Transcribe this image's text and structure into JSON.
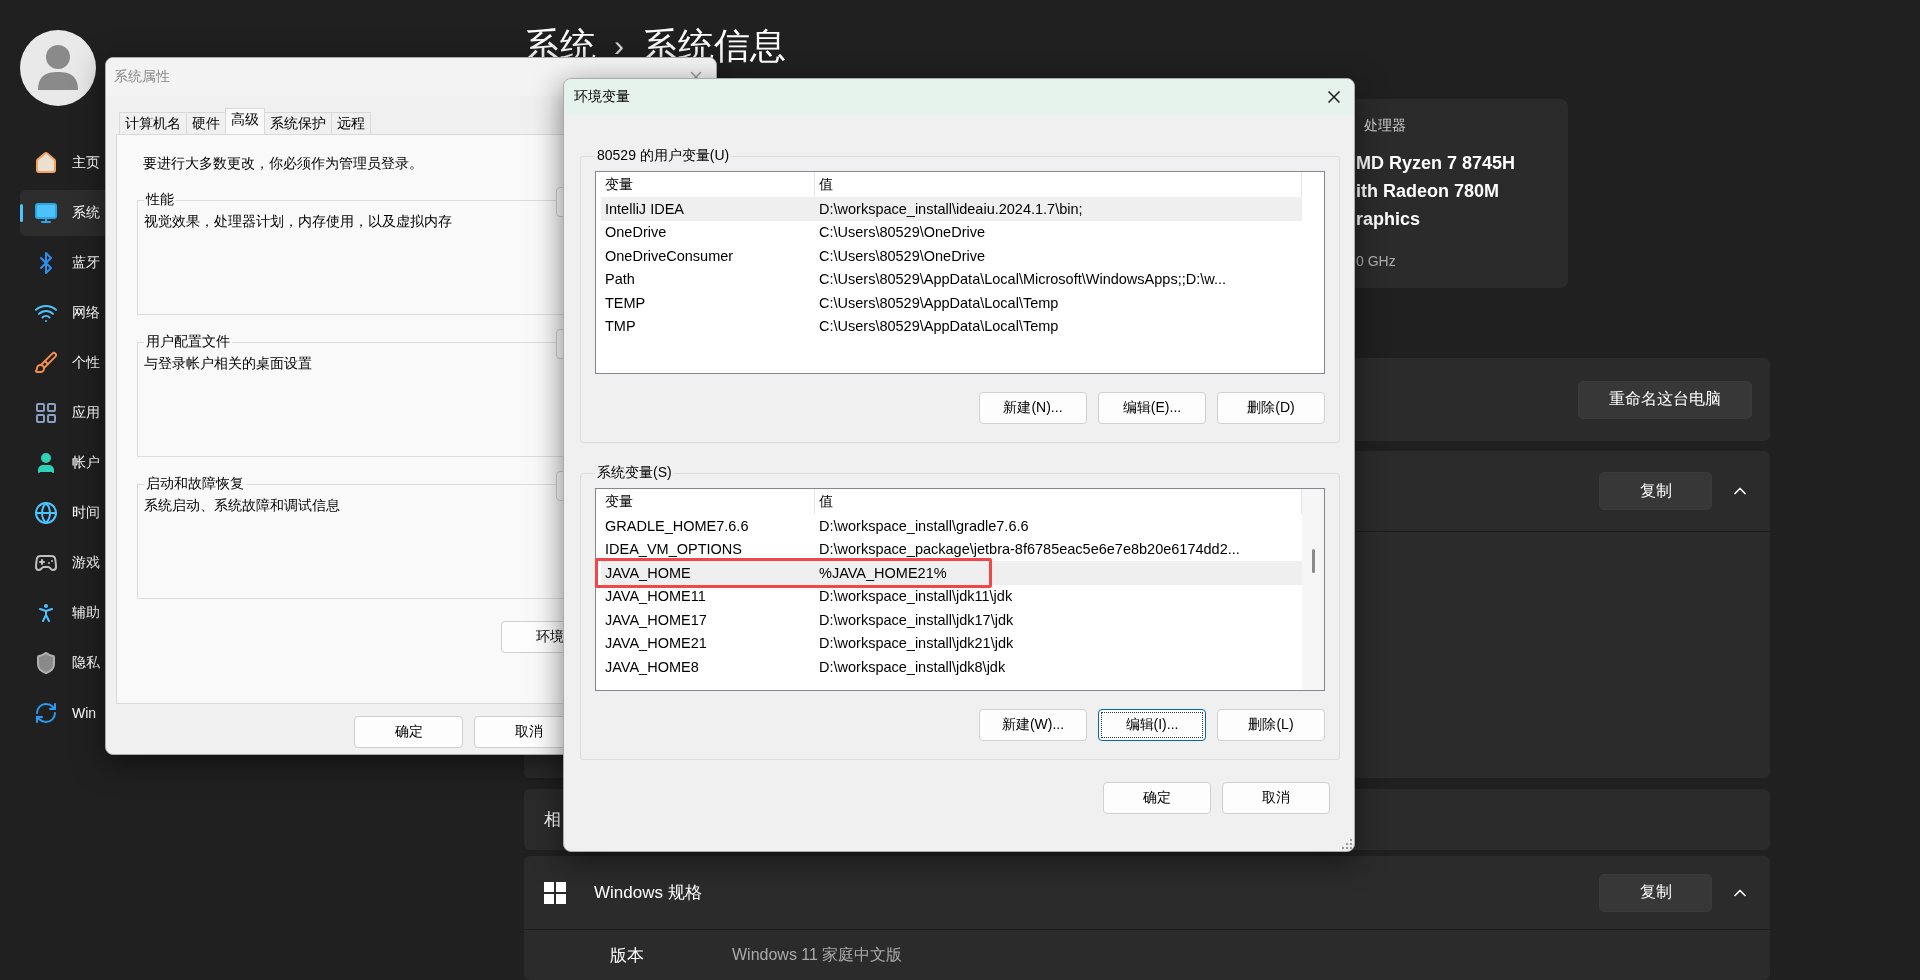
{
  "settings": {
    "breadcrumb": [
      "系统",
      "系统信息"
    ],
    "separator": "›",
    "nav": [
      {
        "label": "主页",
        "selected": false
      },
      {
        "label": "系统",
        "selected": true
      },
      {
        "label": "蓝牙",
        "selected": false
      },
      {
        "label": "网络",
        "selected": false
      },
      {
        "label": "个性",
        "selected": false
      },
      {
        "label": "应用",
        "selected": false
      },
      {
        "label": "帐户",
        "selected": false
      },
      {
        "label": "时间",
        "selected": false
      },
      {
        "label": "游戏",
        "selected": false
      },
      {
        "label": "辅助",
        "selected": false
      },
      {
        "label": "隐私",
        "selected": false
      },
      {
        "label": "Win",
        "selected": false
      }
    ],
    "processor": {
      "label": "处理器",
      "name_lines": [
        "MD Ryzen 7 8745H",
        "ith Radeon 780M",
        "raphics"
      ],
      "speed": "0 GHz"
    },
    "rename_button": "重命名这台电脑",
    "device_spec": {
      "copy_button": "复制",
      "expanded": true
    },
    "related": {
      "title": "相"
    },
    "windows_spec": {
      "title": "Windows 规格",
      "copy_button": "复制",
      "expanded": true,
      "rows": [
        {
          "label": "版本",
          "value": "Windows 11 家庭中文版"
        }
      ]
    }
  },
  "system_properties": {
    "title": "系统属性",
    "active": false,
    "tabs": [
      {
        "label": "计算机名",
        "selected": false
      },
      {
        "label": "硬件",
        "selected": false
      },
      {
        "label": "高级",
        "selected": true
      },
      {
        "label": "系统保护",
        "selected": false
      },
      {
        "label": "远程",
        "selected": false
      }
    ],
    "notice": "要进行大多数更改，你必须作为管理员登录。",
    "groups": [
      {
        "title": "性能",
        "description": "视觉效果，处理器计划，内存使用，以及虚拟内存"
      },
      {
        "title": "用户配置文件",
        "description": "与登录帐户相关的桌面设置"
      },
      {
        "title": "启动和故障恢复",
        "description": "系统启动、系统故障和调试信息"
      }
    ],
    "env_button": "环境",
    "buttons": [
      "确定",
      "取消"
    ]
  },
  "environment_variables": {
    "title": "环境变量",
    "active": true,
    "sections": [
      {
        "title": "80529 的用户变量(U)",
        "columns": [
          "变量",
          "值"
        ],
        "rows": [
          {
            "name": "IntelliJ IDEA",
            "value": "D:\\workspace_install\\ideaiu.2024.1.7\\bin;",
            "selected": true,
            "highlighted": false
          },
          {
            "name": "OneDrive",
            "value": "C:\\Users\\80529\\OneDrive",
            "selected": false,
            "highlighted": false
          },
          {
            "name": "OneDriveConsumer",
            "value": "C:\\Users\\80529\\OneDrive",
            "selected": false,
            "highlighted": false
          },
          {
            "name": "Path",
            "value": "C:\\Users\\80529\\AppData\\Local\\Microsoft\\WindowsApps;;D:\\w...",
            "selected": false,
            "highlighted": false
          },
          {
            "name": "TEMP",
            "value": "C:\\Users\\80529\\AppData\\Local\\Temp",
            "selected": false,
            "highlighted": false
          },
          {
            "name": "TMP",
            "value": "C:\\Users\\80529\\AppData\\Local\\Temp",
            "selected": false,
            "highlighted": false
          }
        ],
        "buttons": [
          {
            "label": "新建(N)...",
            "focused": false
          },
          {
            "label": "编辑(E)...",
            "focused": false
          },
          {
            "label": "删除(D)",
            "focused": false
          }
        ]
      },
      {
        "title": "系统变量(S)",
        "columns": [
          "变量",
          "值"
        ],
        "scrollbar": true,
        "rows": [
          {
            "name": "GRADLE_HOME7.6.6",
            "value": "D:\\workspace_install\\gradle7.6.6",
            "selected": false,
            "highlighted": false
          },
          {
            "name": "IDEA_VM_OPTIONS",
            "value": "D:\\workspace_package\\jetbra-8f6785eac5e6e7e8b20e6174dd2...",
            "selected": false,
            "highlighted": false
          },
          {
            "name": "JAVA_HOME",
            "value": "%JAVA_HOME21%",
            "selected": true,
            "highlighted": true
          },
          {
            "name": "JAVA_HOME11",
            "value": "D:\\workspace_install\\jdk11\\jdk",
            "selected": false,
            "highlighted": false
          },
          {
            "name": "JAVA_HOME17",
            "value": "D:\\workspace_install\\jdk17\\jdk",
            "selected": false,
            "highlighted": false
          },
          {
            "name": "JAVA_HOME21",
            "value": "D:\\workspace_install\\jdk21\\jdk",
            "selected": false,
            "highlighted": false
          },
          {
            "name": "JAVA_HOME8",
            "value": "D:\\workspace_install\\jdk8\\jdk",
            "selected": false,
            "highlighted": false
          }
        ],
        "buttons": [
          {
            "label": "新建(W)...",
            "focused": false
          },
          {
            "label": "编辑(I)...",
            "focused": true
          },
          {
            "label": "删除(L)",
            "focused": false
          }
        ]
      }
    ],
    "buttons": [
      "确定",
      "取消"
    ]
  }
}
